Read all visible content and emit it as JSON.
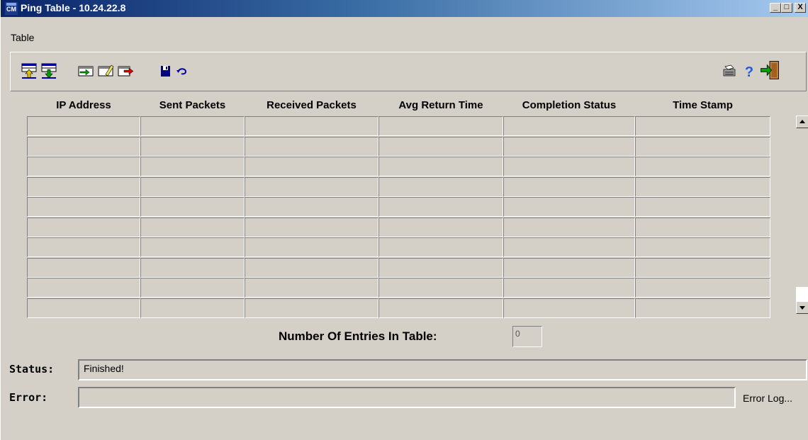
{
  "window": {
    "title": "Ping Table - 10.24.22.8",
    "app_icon_text": "CM",
    "controls": {
      "minimize": "_",
      "maximize": "□",
      "close": "X"
    }
  },
  "menu": {
    "items": [
      "Table"
    ]
  },
  "toolbar": {
    "icons": [
      "upload-table-icon",
      "download-table-icon",
      "add-entry-icon",
      "edit-entry-icon",
      "export-entry-icon",
      "save-icon",
      "undo-icon",
      "print-icon",
      "help-icon",
      "exit-icon"
    ]
  },
  "table": {
    "columns": [
      "IP Address",
      "Sent Packets",
      "Received Packets",
      "Avg Return Time",
      "Completion Status",
      "Time Stamp"
    ],
    "rows": []
  },
  "entries": {
    "label": "Number Of Entries In Table:",
    "value": "0"
  },
  "status": {
    "label": "Status:",
    "value": "Finished!"
  },
  "error": {
    "label": "Error:",
    "value": "",
    "log_button": "Error Log..."
  },
  "colors": {
    "face": "#d4d0c8",
    "title_start": "#0a246a",
    "title_end": "#a6caf0"
  }
}
